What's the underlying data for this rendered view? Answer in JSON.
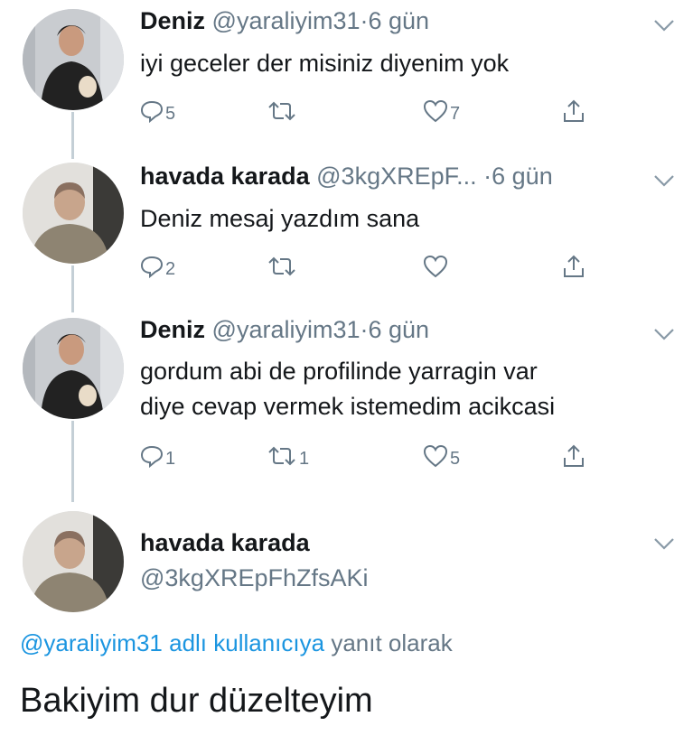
{
  "tweets": [
    {
      "name": "Deniz",
      "handle": "@yaraliyim31",
      "dot": "·",
      "time": "6 gün",
      "text": "iyi geceler der misiniz diyenim yok",
      "replies": "5",
      "retweets": "",
      "likes": "7"
    },
    {
      "name": "havada karada",
      "handle": "@3kgXREpF...",
      "dot": "·",
      "time": "6 gün",
      "text": "Deniz mesaj yazdım sana",
      "replies": "2",
      "retweets": "",
      "likes": ""
    },
    {
      "name": "Deniz",
      "handle": "@yaraliyim31",
      "dot": "·",
      "time": "6 gün",
      "text_line1": "gordum abi de profilinde yarragin var",
      "text_line2": "diye cevap vermek istemedim acikcasi",
      "replies": "1",
      "retweets": "1",
      "likes": "5"
    }
  ],
  "focused": {
    "name": "havada karada",
    "handle": "@3kgXREpFhZfsAKi",
    "reply_mention": "@yaraliyim31 adlı kullanıcıya",
    "reply_suffix": " yanıt olarak",
    "text": "Bakiyim dur düzelteyim"
  },
  "colors": {
    "secondary_text": "#657786",
    "link": "#1b95e0",
    "thread_line": "#c4cfd6"
  },
  "icons": [
    "reply-icon",
    "retweet-icon",
    "like-icon",
    "share-icon",
    "chevron-down-icon"
  ]
}
